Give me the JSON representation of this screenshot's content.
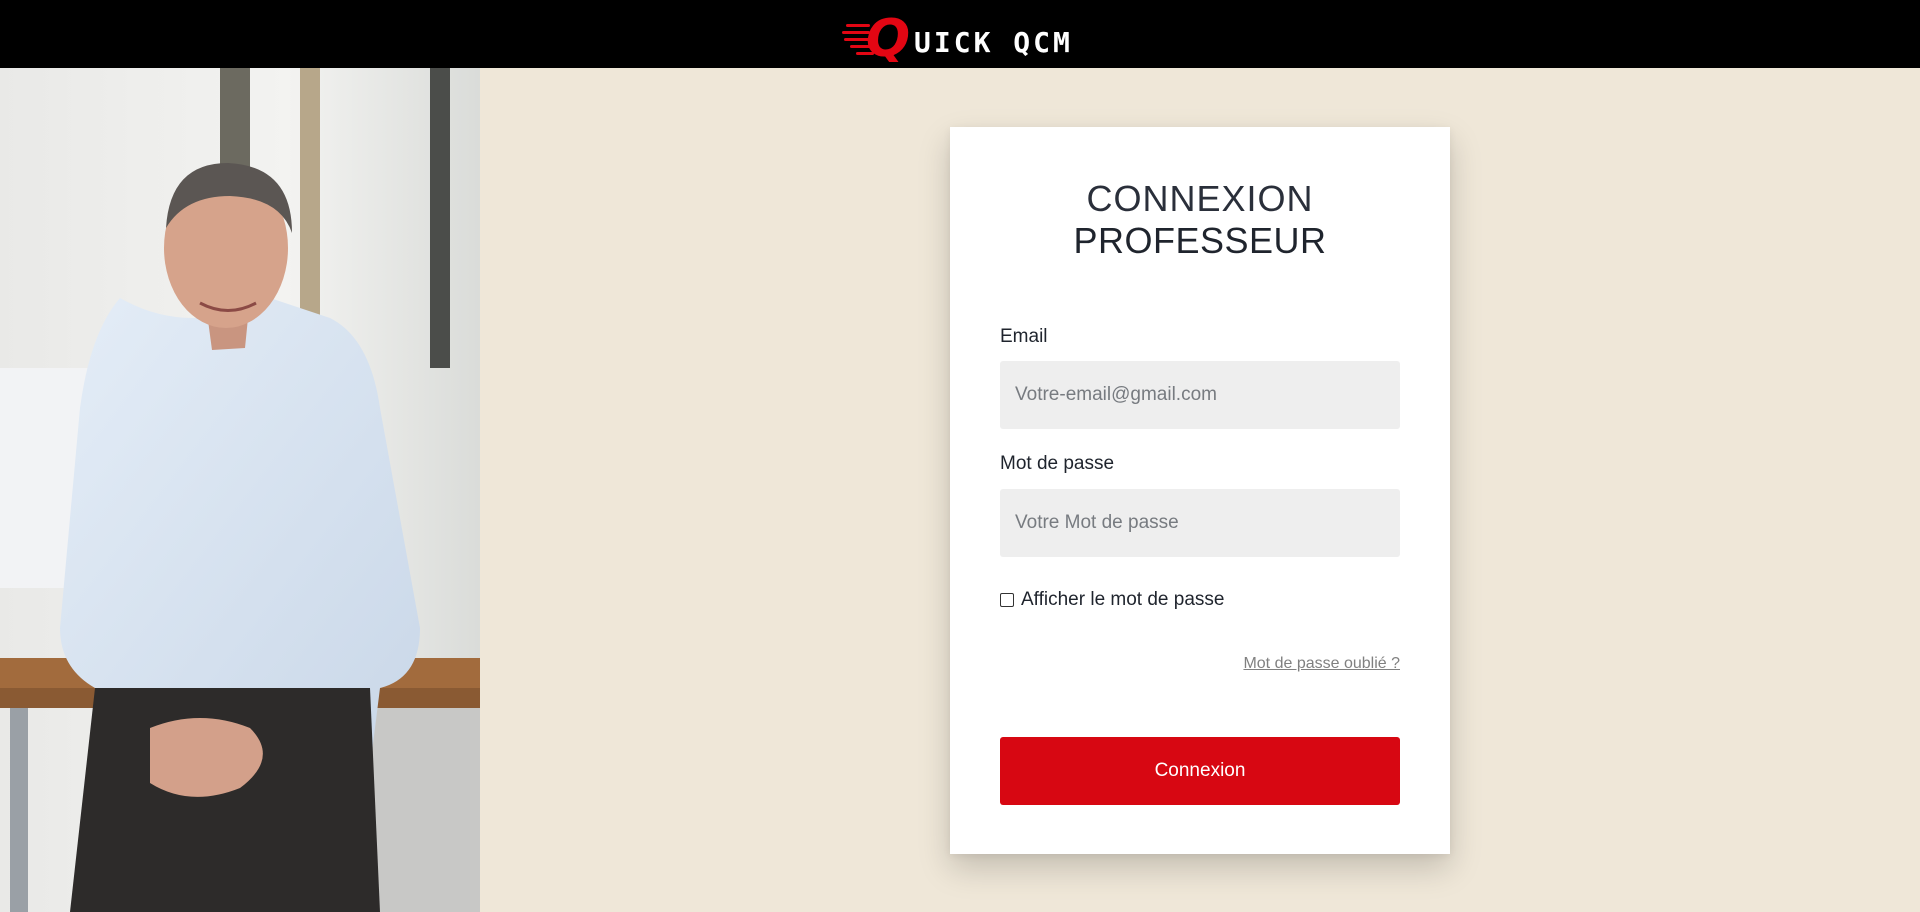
{
  "header": {
    "logo_text": "UICK QCM",
    "logo_letter": "Q"
  },
  "hero_image": {
    "alt": ""
  },
  "login": {
    "title_line1": "CONNEXION",
    "title_line2": "PROFESSEUR",
    "email_label": "Email",
    "email_placeholder": "Votre-email@gmail.com",
    "password_label": "Mot de passe",
    "password_placeholder": "Votre Mot de passe",
    "show_password_label": "Afficher le mot de passe",
    "show_password_checked": false,
    "forgot_label": "Mot de passe oublié ?",
    "submit_label": "Connexion"
  },
  "colors": {
    "accent": "#d70712",
    "page_background": "#efe7d8",
    "header_background": "#000000",
    "input_background": "#eeeeee"
  }
}
